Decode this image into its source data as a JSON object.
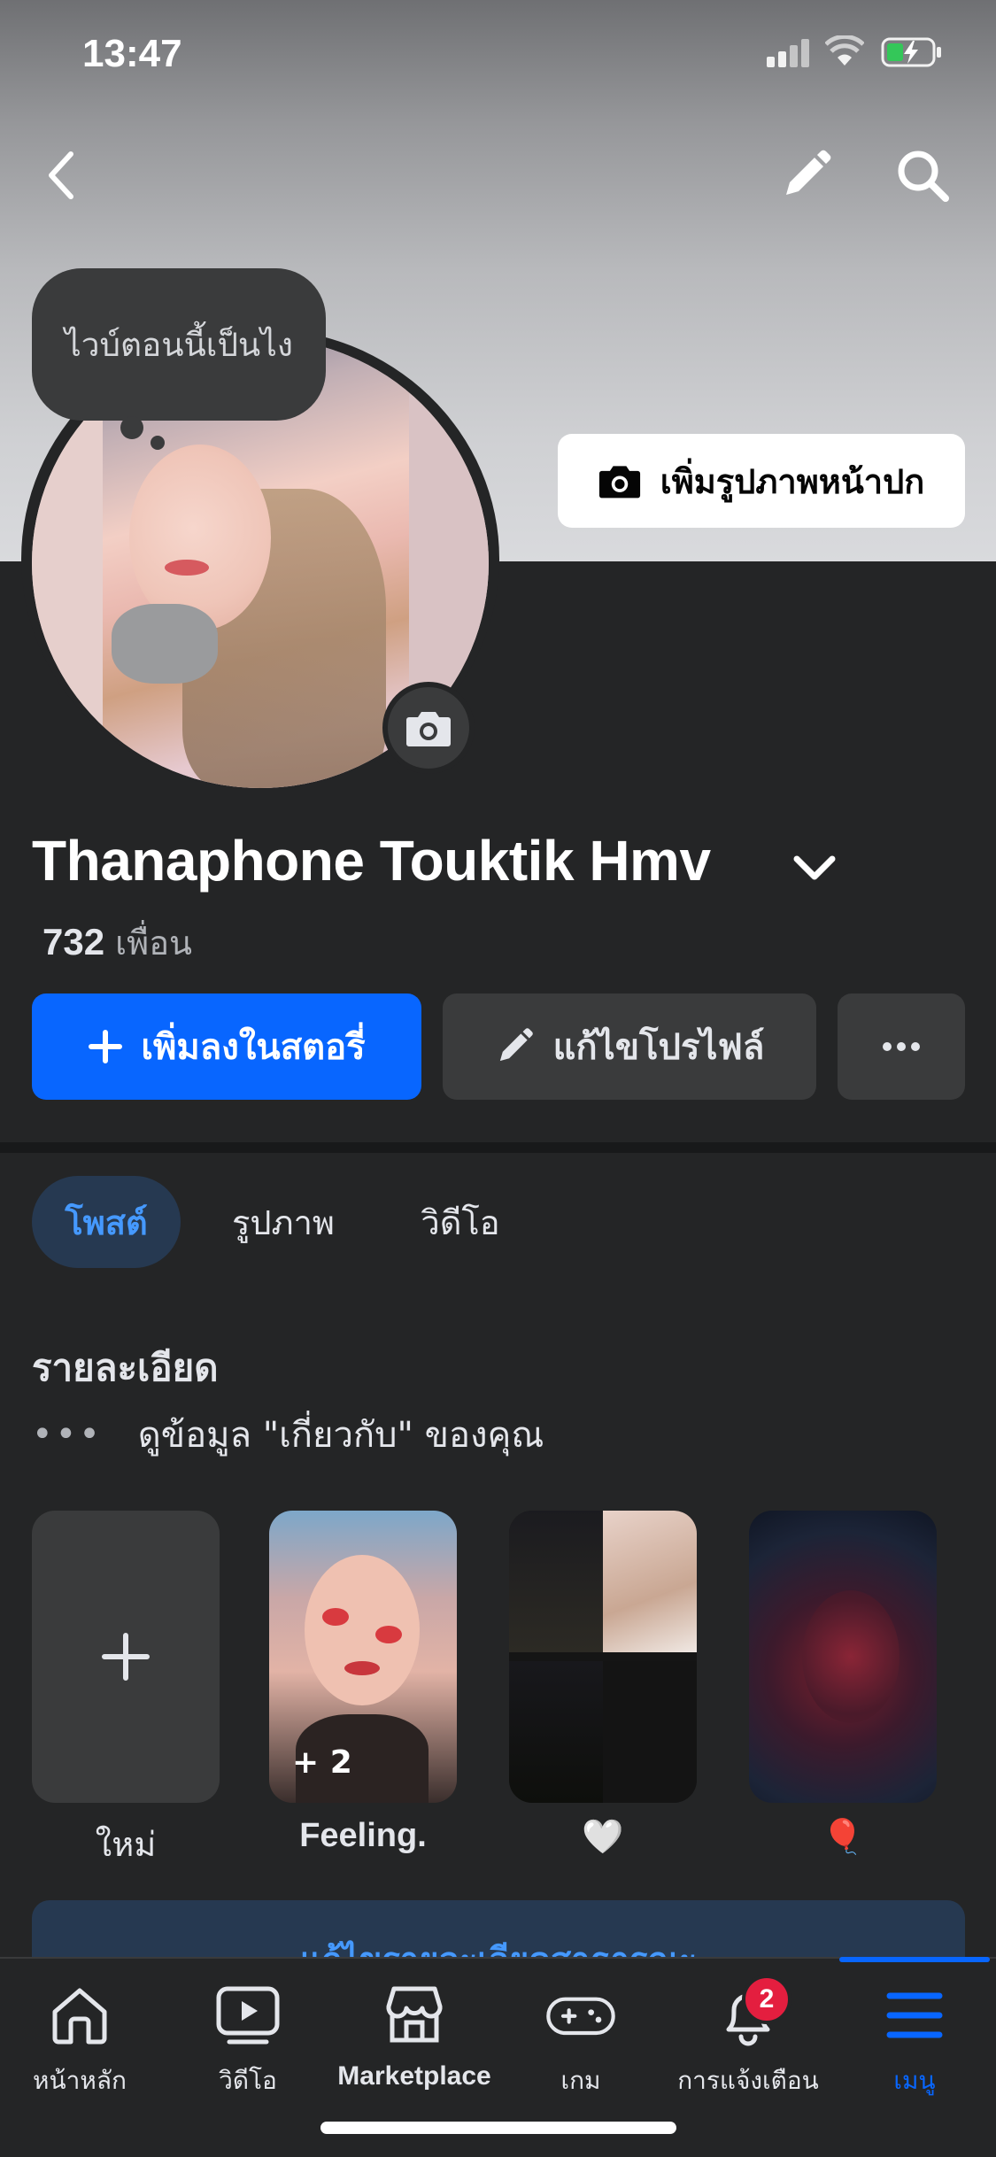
{
  "status_bar": {
    "time": "13:47"
  },
  "cover": {
    "add_cover_photo_label": "เพิ่มรูปภาพหน้าปก"
  },
  "story_bubble": {
    "text": "ไวบ์ตอนนี้เป็นไง"
  },
  "profile": {
    "name": "Thanaphone Touktik Hmv",
    "friends_count": "732",
    "friends_label": "เพื่อน"
  },
  "actions": {
    "add_story_label": "เพิ่มลงในสตอรี่",
    "edit_profile_label": "แก้ไขโปรไฟล์"
  },
  "tabs": [
    {
      "label": "โพสต์",
      "active": true
    },
    {
      "label": "รูปภาพ",
      "active": false
    },
    {
      "label": "วิดีโอ",
      "active": false
    }
  ],
  "details": {
    "title": "รายละเอียด",
    "about_link": "ดูข้อมูล \"เกี่ยวกับ\" ของคุณ"
  },
  "featured": [
    {
      "label": "ใหม่",
      "type": "new"
    },
    {
      "label": "Feeling.",
      "extra_count": "+ 2"
    },
    {
      "label": "🤍"
    },
    {
      "label": "🎈"
    }
  ],
  "edit_public_details_label": "แก้ไขรายละเอียดสาธารณะ",
  "bottom_nav": [
    {
      "label": "หน้าหลัก",
      "icon": "home-icon"
    },
    {
      "label": "วิดีโอ",
      "icon": "video-icon"
    },
    {
      "label": "Marketplace",
      "icon": "marketplace-icon"
    },
    {
      "label": "เกม",
      "icon": "gaming-icon"
    },
    {
      "label": "การแจ้งเตือน",
      "icon": "bell-icon",
      "badge": "2"
    },
    {
      "label": "เมนู",
      "icon": "menu-icon",
      "active": true
    }
  ],
  "colors": {
    "background": "#242526",
    "primary": "#0866ff",
    "secondary_button": "#3a3b3c",
    "active_tab_bg": "#263951",
    "active_tab_text": "#4599ff",
    "badge": "#e41e3f"
  }
}
